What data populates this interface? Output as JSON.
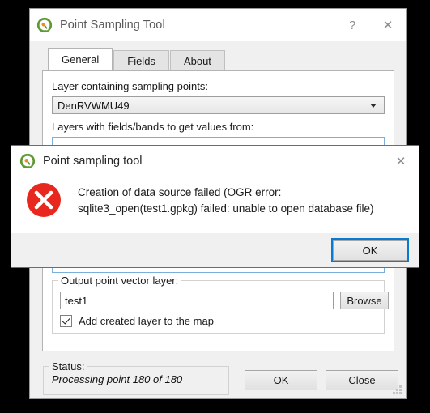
{
  "main_window": {
    "title": "Point Sampling Tool",
    "logo_icon": "qgis-logo-icon",
    "help_button": "?",
    "close_button": "✕",
    "tabs": [
      {
        "label": "General",
        "active": true
      },
      {
        "label": "Fields",
        "active": false
      },
      {
        "label": "About",
        "active": false
      }
    ],
    "general_tab": {
      "layer_label": "Layer containing sampling points:",
      "layer_value": "DenRVWMU49",
      "layers_fields_label": "Layers with fields/bands to get values from:",
      "output_group_legend": "Output point vector layer:",
      "output_value": "test1",
      "browse_button": "Browse",
      "add_layer_checkbox_label": "Add created layer to the map",
      "add_layer_checked": true
    },
    "status_group_legend": "Status:",
    "status_text": "Processing point 180 of 180",
    "ok_button": "OK",
    "close_button_label": "Close",
    "size_grip": "resize-grip-icon"
  },
  "error_dialog": {
    "title": "Point sampling tool",
    "logo_icon": "qgis-logo-icon",
    "close_button": "✕",
    "error_icon": "error-circle-x-icon",
    "message": "Creation of data source failed (OGR error:\nsqlite3_open(test1.gpkg) failed: unable to open database file)",
    "ok_button": "OK"
  },
  "colors": {
    "accent_blue": "#1884d8",
    "error_red": "#e8281e",
    "qgis_green": "#5f9b33",
    "qgis_orange": "#f2892a",
    "window_bg": "#f0f0f0",
    "desktop_bg": "#000000"
  }
}
